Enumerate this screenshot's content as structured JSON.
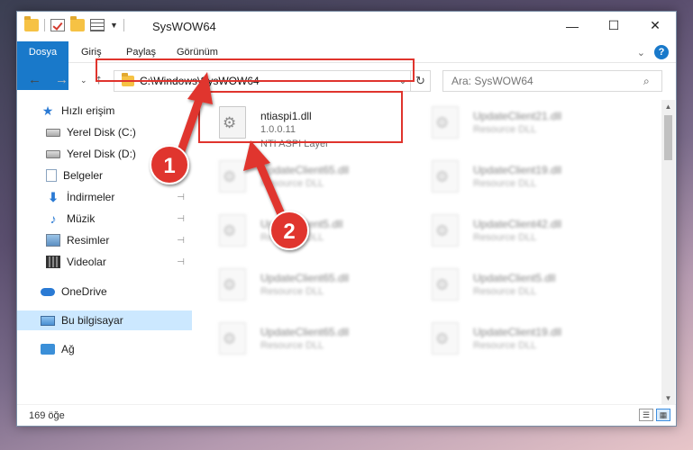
{
  "window": {
    "title": "SysWOW64"
  },
  "titlebar": {
    "minimize": "—",
    "maximize": "☐",
    "close": "✕"
  },
  "ribbon": {
    "tabs": [
      "Dosya",
      "Giriş",
      "Paylaş",
      "Görünüm"
    ],
    "expand": "⌄",
    "help": "?"
  },
  "nav": {
    "back": "←",
    "forward": "→",
    "recent": "⌄",
    "up": "↑",
    "address": "C:\\Windows\\SysWOW64",
    "address_dropdown": "⌄",
    "refresh": "↻",
    "search_placeholder": "Ara: SysWOW64",
    "search_icon": "⌕"
  },
  "sidebar": {
    "items": [
      {
        "label": "Hızlı erişim",
        "icon": "star-icon"
      },
      {
        "label": "Yerel Disk (C:)",
        "icon": "drive-icon",
        "pinned": "⊣"
      },
      {
        "label": "Yerel Disk (D:)",
        "icon": "drive-icon",
        "pinned": "⊣"
      },
      {
        "label": "Belgeler",
        "icon": "documents-icon",
        "pinned": "⊣"
      },
      {
        "label": "İndirmeler",
        "icon": "download-icon",
        "pinned": "⊣"
      },
      {
        "label": "Müzik",
        "icon": "music-icon",
        "pinned": "⊣"
      },
      {
        "label": "Resimler",
        "icon": "pictures-icon",
        "pinned": "⊣"
      },
      {
        "label": "Videolar",
        "icon": "videos-icon",
        "pinned": "⊣"
      },
      {
        "label": "OneDrive",
        "icon": "cloud-icon"
      },
      {
        "label": "Bu bilgisayar",
        "icon": "computer-icon",
        "selected": true
      },
      {
        "label": "Ağ",
        "icon": "network-icon"
      }
    ]
  },
  "files": [
    {
      "name": "ntiaspi1.dll",
      "l2": "1.0.0.11",
      "l3": "NTI ASPI Layer",
      "highlight": true
    },
    {
      "name": "UpdateClient21.dll",
      "l2": "Resource DLL"
    },
    {
      "name": "UpdateClient65.dll",
      "l2": "Resource DLL"
    },
    {
      "name": "UpdateClient19.dll",
      "l2": "Resource DLL"
    },
    {
      "name": "UpdateClient5.dll",
      "l2": "Resource DLL"
    },
    {
      "name": "UpdateClient42.dll",
      "l2": "Resource DLL"
    },
    {
      "name": "UpdateClient65.dll",
      "l2": "Resource DLL"
    },
    {
      "name": "UpdateClient5.dll",
      "l2": "Resource DLL"
    },
    {
      "name": "UpdateClient65.dll",
      "l2": "Resource DLL"
    },
    {
      "name": "UpdateClient19.dll",
      "l2": "Resource DLL"
    }
  ],
  "status": {
    "count": "169 öğe",
    "details_view": "☰",
    "tiles_view": "▦"
  },
  "annotations": {
    "badge1": "1",
    "badge2": "2",
    "accent": "#e0342d"
  }
}
